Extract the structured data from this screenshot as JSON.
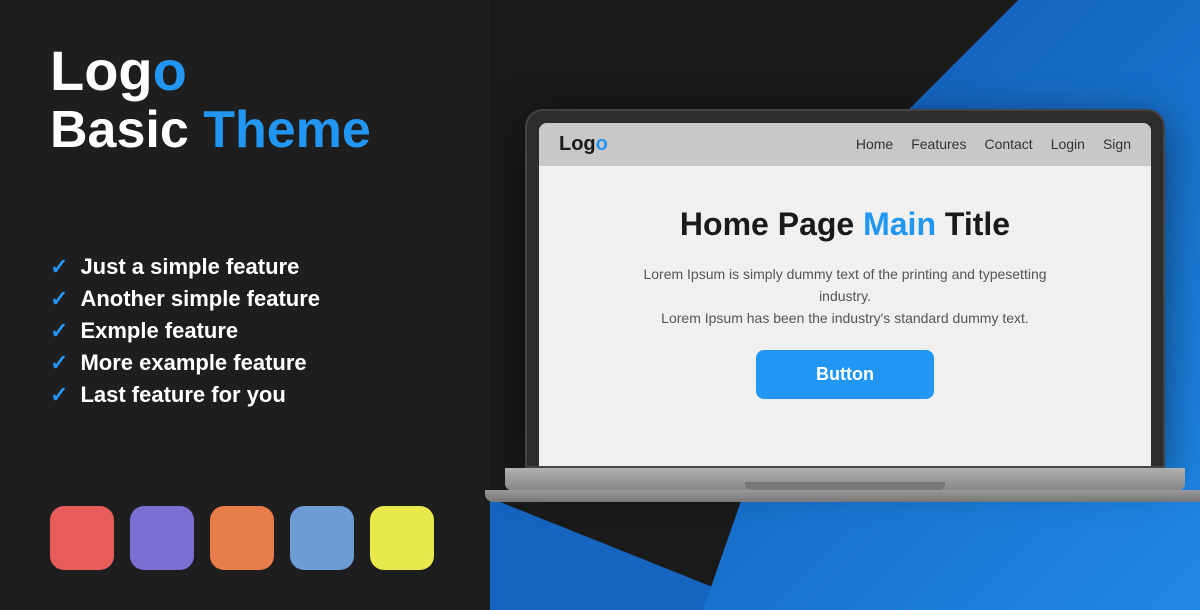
{
  "left": {
    "logo": {
      "text_plain": "Logo",
      "text_blue": "o",
      "display": "Log"
    },
    "subtitle_plain": "Basic ",
    "subtitle_blue": "Theme",
    "features": [
      {
        "id": 1,
        "text": "Just a simple feature"
      },
      {
        "id": 2,
        "text": "Another simple feature"
      },
      {
        "id": 3,
        "text": "Exmple feature"
      },
      {
        "id": 4,
        "text": "More example feature"
      },
      {
        "id": 5,
        "text": "Last feature for you"
      }
    ],
    "swatches": [
      {
        "color": "#e85c5c",
        "label": "red-swatch"
      },
      {
        "color": "#7b6fd4",
        "label": "purple-swatch"
      },
      {
        "color": "#e87c4a",
        "label": "orange-swatch"
      },
      {
        "color": "#6b9cd4",
        "label": "blue-swatch"
      },
      {
        "color": "#e8e84a",
        "label": "yellow-swatch"
      }
    ]
  },
  "browser": {
    "logo_plain": "Log",
    "logo_blue": "o",
    "nav_links": [
      "Home",
      "Features",
      "Contact",
      "Login",
      "Sign"
    ],
    "page_title_plain": "Home Page ",
    "page_title_blue": "Main",
    "page_title_end": " Title",
    "description_line1": "Lorem Ipsum is simply dummy text of the printing and typesetting industry.",
    "description_line2": "Lorem Ipsum has been the industry's standard dummy text.",
    "button_label": "Button"
  }
}
